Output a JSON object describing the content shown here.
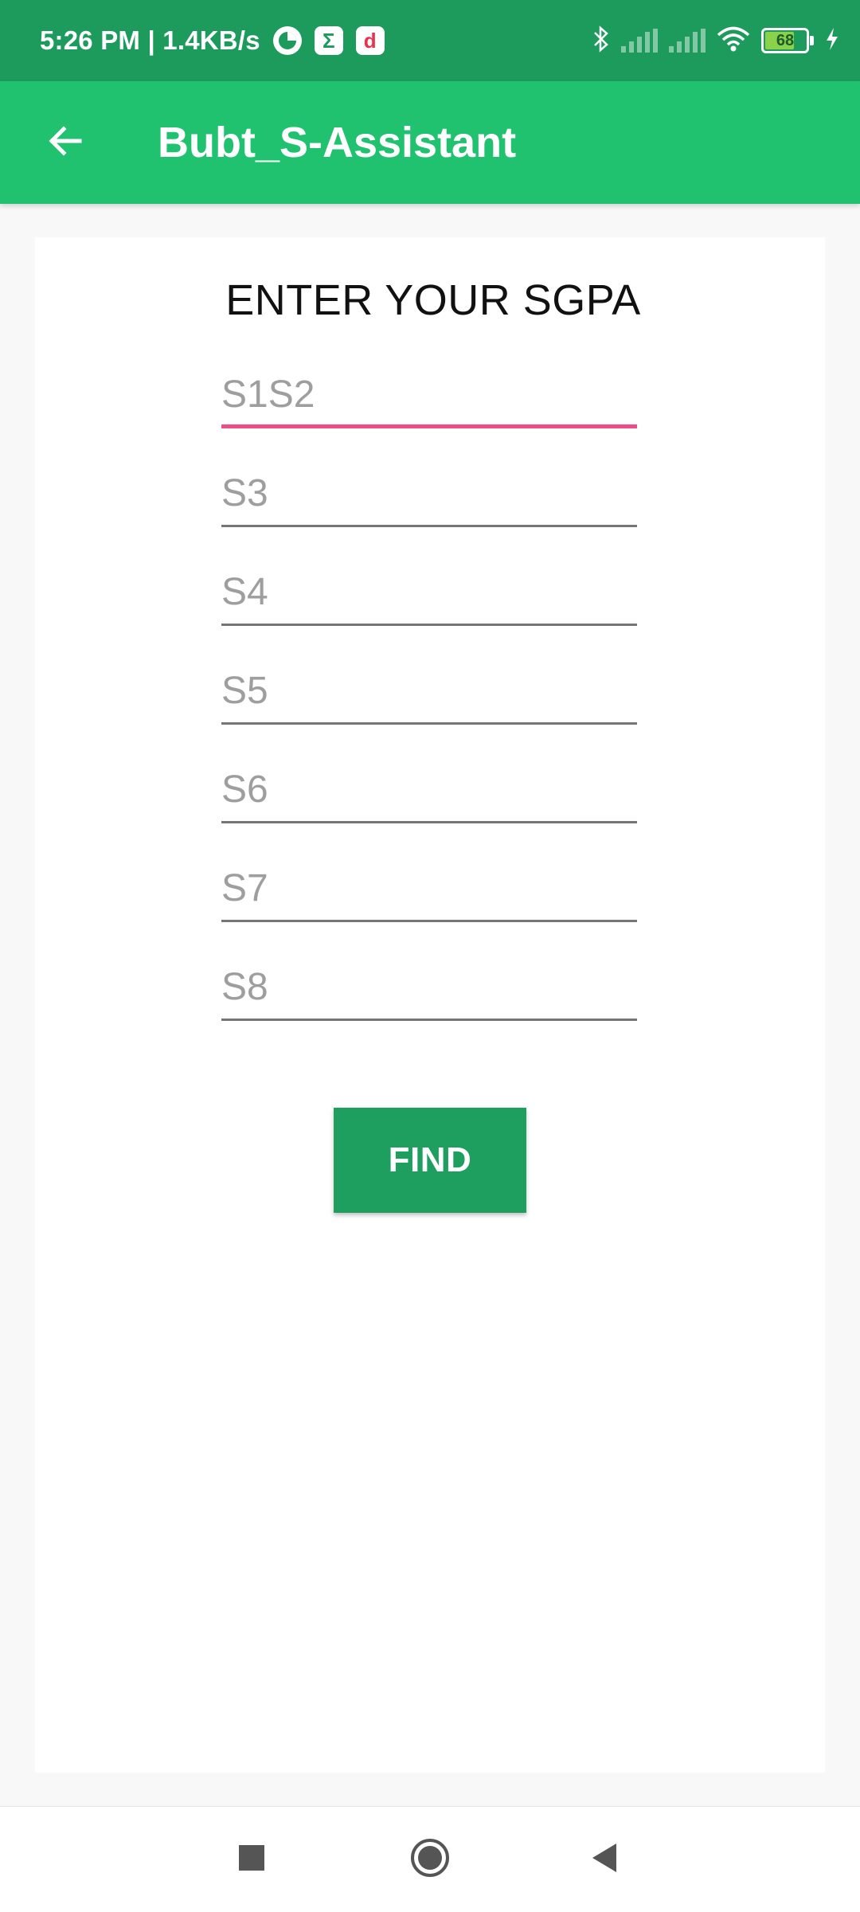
{
  "status_bar": {
    "time_speed": "5:26 PM | 1.4KB/s",
    "battery_level": "68",
    "icons": [
      "data-saver-icon",
      "sigma-app-icon",
      "d-app-icon",
      "bluetooth-icon",
      "signal-icon",
      "signal-icon",
      "wifi-icon",
      "battery-icon",
      "charging-icon"
    ]
  },
  "app_bar": {
    "title": "Bubt_S-Assistant",
    "back_icon": "arrow-back-icon"
  },
  "form": {
    "heading": "ENTER YOUR SGPA",
    "fields": [
      {
        "placeholder": "S1S2",
        "value": ""
      },
      {
        "placeholder": "S3",
        "value": ""
      },
      {
        "placeholder": "S4",
        "value": ""
      },
      {
        "placeholder": "S5",
        "value": ""
      },
      {
        "placeholder": "S6",
        "value": ""
      },
      {
        "placeholder": "S7",
        "value": ""
      },
      {
        "placeholder": "S8",
        "value": ""
      }
    ],
    "button_label": "FIND"
  },
  "colors": {
    "status_bar": "#1c9b5c",
    "app_bar": "#20c270",
    "accent": "#ef4b86",
    "button": "#1e9e5f"
  },
  "nav_bar": {
    "icons": [
      "recents-square-icon",
      "home-circle-icon",
      "back-triangle-icon"
    ]
  }
}
